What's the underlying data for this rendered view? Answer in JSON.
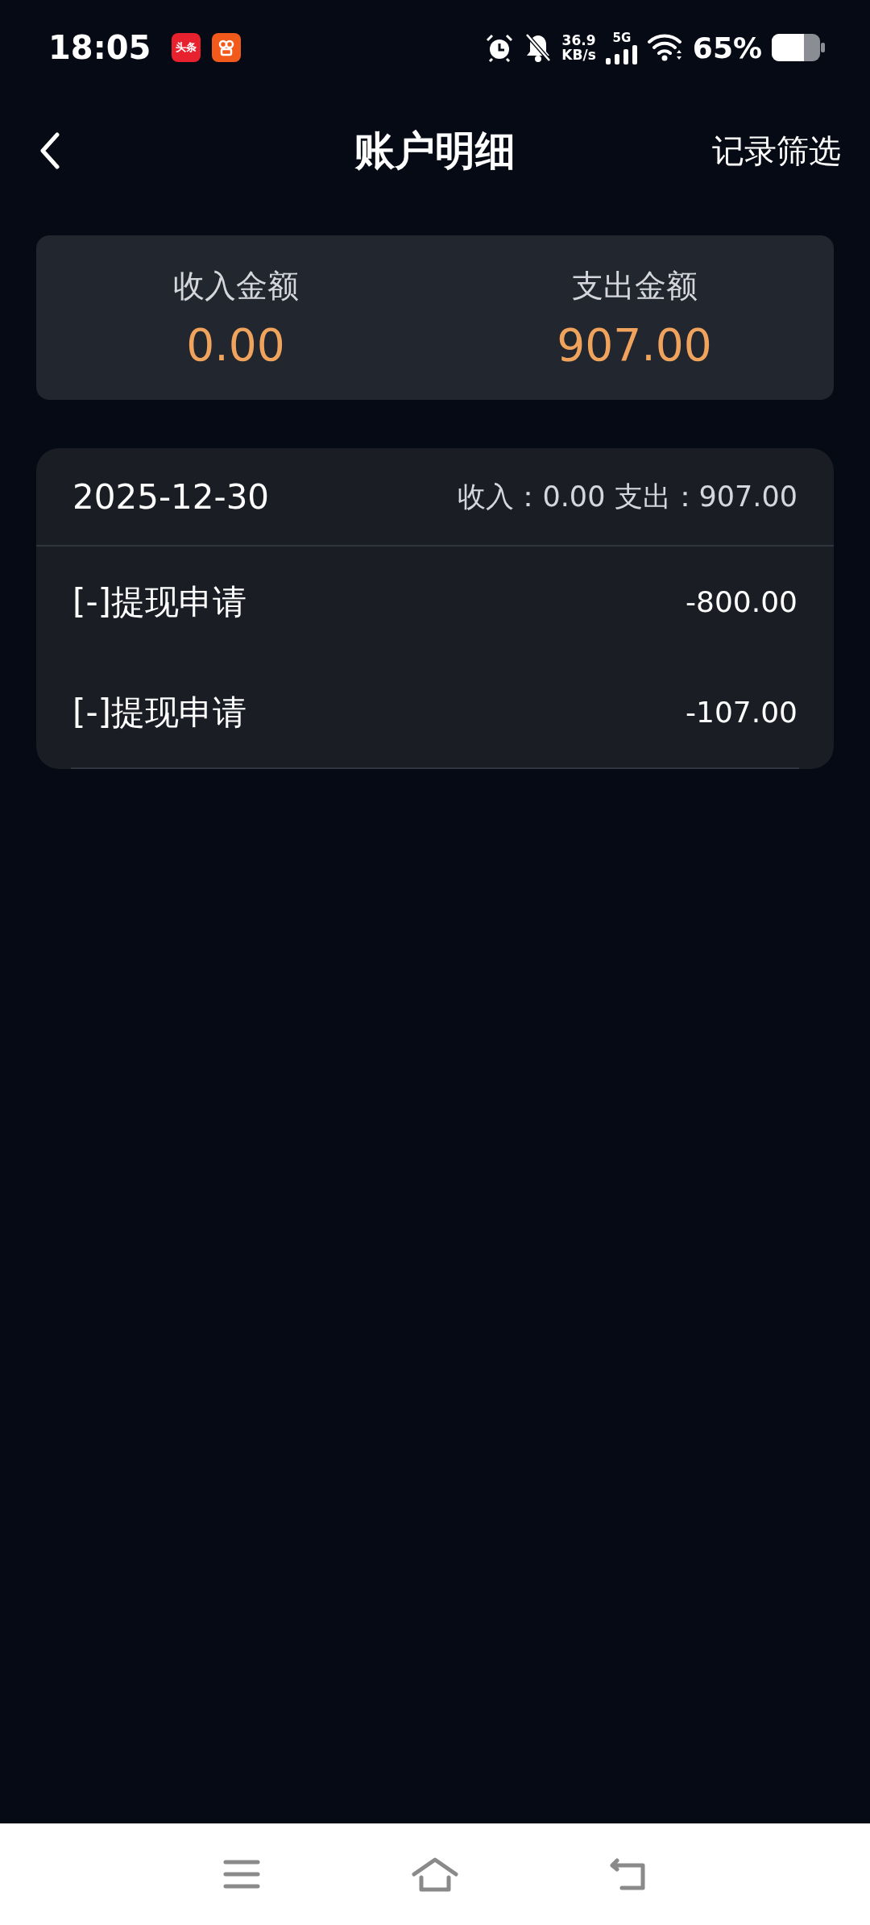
{
  "status_bar": {
    "time": "18:05",
    "app_icons": [
      {
        "label": "头条",
        "color": "#e8212e"
      },
      {
        "color": "#f25a1c"
      }
    ],
    "speed": "36.9",
    "speed_unit": "KB/s",
    "network": "5G",
    "battery": "65%"
  },
  "header": {
    "title": "账户明细",
    "action": "记录筛选"
  },
  "summary": [
    {
      "label": "收入金额",
      "amount": "0.00"
    },
    {
      "label": "支出金额",
      "amount": "907.00"
    }
  ],
  "groups": [
    {
      "date": "2025-12-30",
      "totals": "收入：0.00 支出：907.00",
      "records": [
        {
          "title": "[-]提现申请",
          "amount": "-800.00"
        },
        {
          "title": "[-]提现申请",
          "amount": "-107.00"
        }
      ]
    }
  ]
}
